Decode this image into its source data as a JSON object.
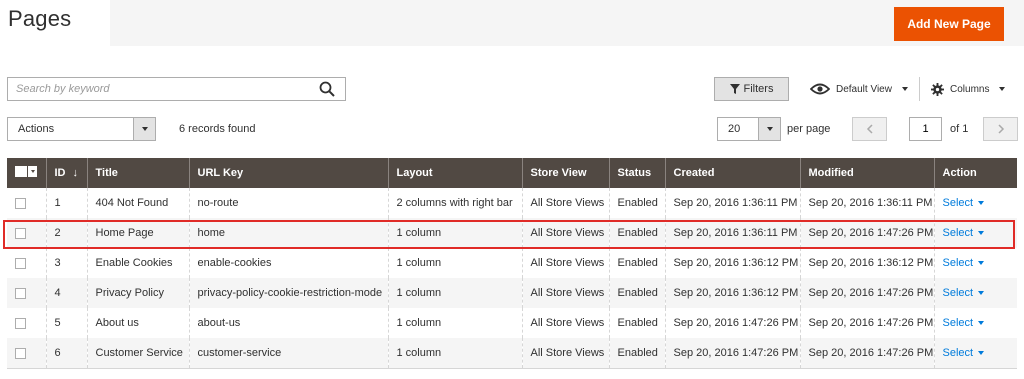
{
  "header": {
    "title": "Pages",
    "add_button": "Add New Page"
  },
  "toolbar": {
    "search_placeholder": "Search by keyword",
    "filters_label": "Filters",
    "view_label": "Default View",
    "columns_label": "Columns"
  },
  "mass_actions": {
    "actions_label": "Actions",
    "records_found": "6 records found"
  },
  "pagination": {
    "per_page_value": "20",
    "per_page_label": "per page",
    "current_page": "1",
    "of_label": "of 1"
  },
  "grid": {
    "columns": [
      "ID",
      "Title",
      "URL Key",
      "Layout",
      "Store View",
      "Status",
      "Created",
      "Modified",
      "Action"
    ],
    "rows": [
      {
        "id": "1",
        "title": "404 Not Found",
        "url_key": "no-route",
        "layout": "2 columns with right bar",
        "store_view": "All Store Views",
        "status": "Enabled",
        "created": "Sep 20, 2016 1:36:11 PM",
        "modified": "Sep 20, 2016 1:36:11 PM",
        "action": "Select"
      },
      {
        "id": "2",
        "title": "Home Page",
        "url_key": "home",
        "layout": "1 column",
        "store_view": "All Store Views",
        "status": "Enabled",
        "created": "Sep 20, 2016 1:36:11 PM",
        "modified": "Sep 20, 2016 1:47:26 PM",
        "action": "Select"
      },
      {
        "id": "3",
        "title": "Enable Cookies",
        "url_key": "enable-cookies",
        "layout": "1 column",
        "store_view": "All Store Views",
        "status": "Enabled",
        "created": "Sep 20, 2016 1:36:12 PM",
        "modified": "Sep 20, 2016 1:36:12 PM",
        "action": "Select"
      },
      {
        "id": "4",
        "title": "Privacy Policy",
        "url_key": "privacy-policy-cookie-restriction-mode",
        "layout": "1 column",
        "store_view": "All Store Views",
        "status": "Enabled",
        "created": "Sep 20, 2016 1:36:12 PM",
        "modified": "Sep 20, 2016 1:47:26 PM",
        "action": "Select"
      },
      {
        "id": "5",
        "title": "About us",
        "url_key": "about-us",
        "layout": "1 column",
        "store_view": "All Store Views",
        "status": "Enabled",
        "created": "Sep 20, 2016 1:47:26 PM",
        "modified": "Sep 20, 2016 1:47:26 PM",
        "action": "Select"
      },
      {
        "id": "6",
        "title": "Customer Service",
        "url_key": "customer-service",
        "layout": "1 column",
        "store_view": "All Store Views",
        "status": "Enabled",
        "created": "Sep 20, 2016 1:47:26 PM",
        "modified": "Sep 20, 2016 1:47:26 PM",
        "action": "Select"
      }
    ]
  },
  "colors": {
    "accent": "#eb5202",
    "header_bg": "#514943",
    "link": "#007bdb",
    "highlight": "#e02b27"
  },
  "icons": {
    "search": "search-icon",
    "filter": "funnel-icon",
    "view": "eye-icon",
    "columns": "gear-icon"
  }
}
